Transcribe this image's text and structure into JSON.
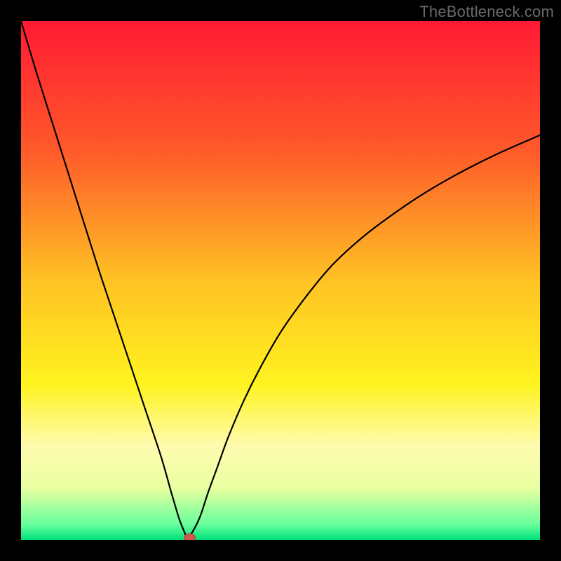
{
  "watermark": "TheBottleneck.com",
  "chart_data": {
    "type": "line",
    "title": "",
    "xlabel": "",
    "ylabel": "",
    "xlim": [
      0,
      100
    ],
    "ylim": [
      0,
      100
    ],
    "grid": false,
    "legend": false,
    "background_gradient": {
      "stops": [
        {
          "pos": 0.0,
          "color": "#ff1a33"
        },
        {
          "pos": 0.25,
          "color": "#ff5a2a"
        },
        {
          "pos": 0.5,
          "color": "#ffc224"
        },
        {
          "pos": 0.7,
          "color": "#fff31f"
        },
        {
          "pos": 0.82,
          "color": "#fffbb0"
        },
        {
          "pos": 0.9,
          "color": "#e9ffa0"
        },
        {
          "pos": 0.97,
          "color": "#66ff9c"
        },
        {
          "pos": 1.0,
          "color": "#00e07a"
        }
      ]
    },
    "series": [
      {
        "name": "bottleneck-curve",
        "x": [
          0.0,
          3.0,
          6.0,
          9.0,
          12.0,
          15.0,
          18.0,
          21.0,
          24.0,
          27.0,
          29.0,
          30.5,
          31.5,
          32.0,
          33.0,
          34.5,
          36.0,
          38.0,
          40.0,
          43.0,
          46.0,
          50.0,
          55.0,
          60.0,
          66.0,
          72.0,
          78.0,
          85.0,
          92.0,
          100.0
        ],
        "y": [
          100.0,
          90.0,
          80.5,
          71.0,
          61.5,
          52.0,
          43.0,
          34.0,
          25.0,
          16.0,
          9.0,
          4.0,
          1.5,
          0.5,
          1.5,
          4.5,
          9.0,
          14.5,
          20.0,
          27.0,
          33.0,
          40.0,
          47.0,
          53.0,
          58.5,
          63.0,
          67.0,
          71.0,
          74.5,
          78.0
        ]
      }
    ],
    "marker": {
      "x": 32.5,
      "y": 0.0,
      "color": "#cc5a4a"
    }
  }
}
